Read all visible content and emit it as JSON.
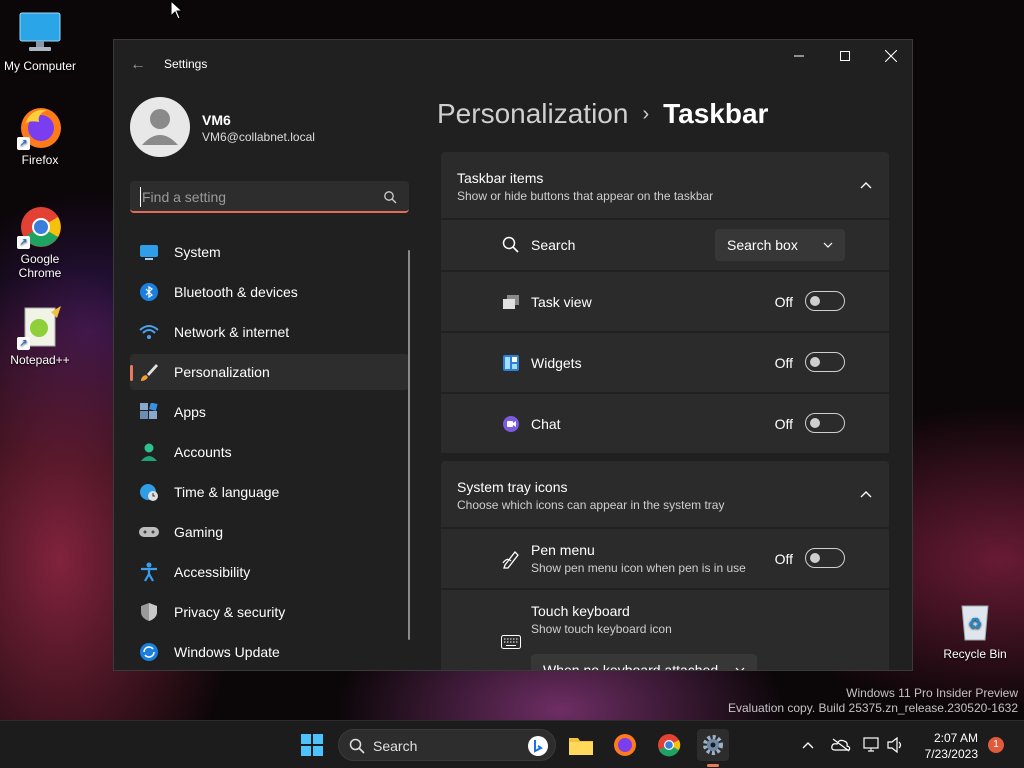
{
  "desktop": {
    "icons": [
      {
        "label": "My Computer"
      },
      {
        "label": "Firefox"
      },
      {
        "label": "Google Chrome"
      },
      {
        "label": "Notepad++"
      },
      {
        "label": "Recycle Bin"
      }
    ],
    "watermark": {
      "line1": "Windows 11 Pro Insider Preview",
      "line2": "Evaluation copy. Build 25375.zn_release.230520-1632"
    }
  },
  "window": {
    "title": "Settings",
    "user": {
      "name": "VM6",
      "email": "VM6@collabnet.local"
    },
    "search": {
      "placeholder": "Find a setting"
    },
    "nav": [
      {
        "label": "System",
        "icon": "monitor-icon"
      },
      {
        "label": "Bluetooth & devices",
        "icon": "bluetooth-icon"
      },
      {
        "label": "Network & internet",
        "icon": "wifi-icon"
      },
      {
        "label": "Personalization",
        "icon": "brush-icon",
        "active": true
      },
      {
        "label": "Apps",
        "icon": "apps-icon"
      },
      {
        "label": "Accounts",
        "icon": "person-icon"
      },
      {
        "label": "Time & language",
        "icon": "globe-clock-icon"
      },
      {
        "label": "Gaming",
        "icon": "gamepad-icon"
      },
      {
        "label": "Accessibility",
        "icon": "accessibility-icon"
      },
      {
        "label": "Privacy & security",
        "icon": "shield-icon"
      },
      {
        "label": "Windows Update",
        "icon": "update-icon"
      }
    ],
    "breadcrumb": {
      "parent": "Personalization",
      "separator": "›",
      "current": "Taskbar"
    },
    "taskbar_items": {
      "title": "Taskbar items",
      "subtitle": "Show or hide buttons that appear on the taskbar",
      "search": {
        "label": "Search",
        "value": "Search box"
      },
      "task_view": {
        "label": "Task view",
        "state": "Off"
      },
      "widgets": {
        "label": "Widgets",
        "state": "Off"
      },
      "chat": {
        "label": "Chat",
        "state": "Off"
      }
    },
    "system_tray": {
      "title": "System tray icons",
      "subtitle": "Choose which icons can appear in the system tray",
      "pen_menu": {
        "label": "Pen menu",
        "desc": "Show pen menu icon when pen is in use",
        "state": "Off"
      },
      "touch_keyboard": {
        "label": "Touch keyboard",
        "desc": "Show touch keyboard icon",
        "value": "When no keyboard attached"
      }
    }
  },
  "taskbar": {
    "search_label": "Search",
    "time": "2:07 AM",
    "date": "7/23/2023",
    "notification_count": "1"
  },
  "colors": {
    "accent": "#e97b5b",
    "window_bg": "#202020",
    "card_bg": "#2b2b2b"
  }
}
